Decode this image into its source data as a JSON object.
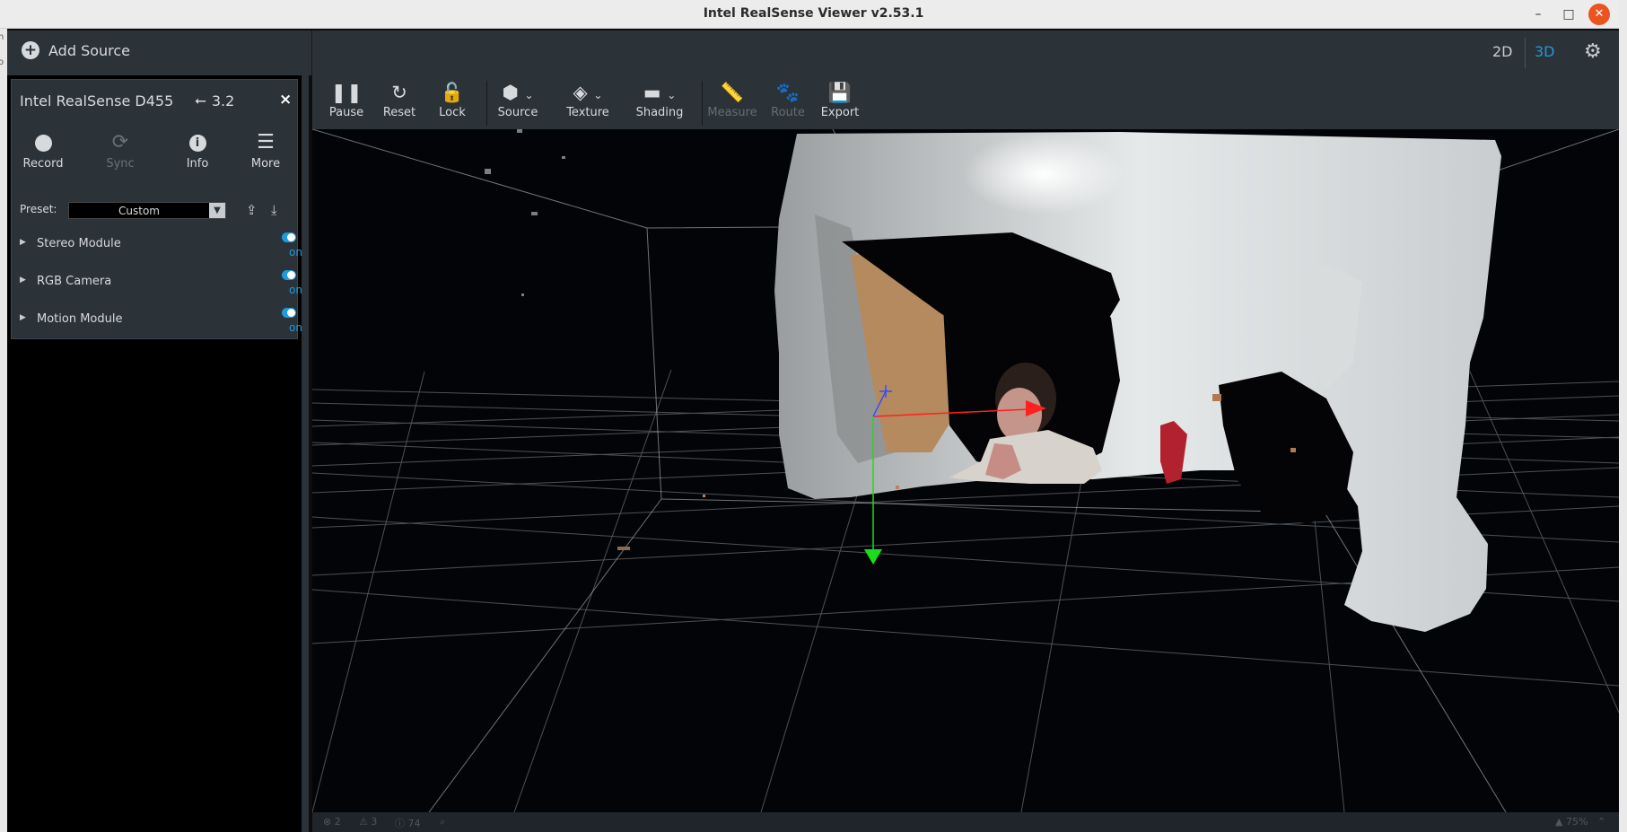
{
  "window": {
    "title": "Intel RealSense Viewer v2.53.1",
    "minimize": "–",
    "maximize": "□",
    "close": "✕"
  },
  "left_edge": {
    "top_fragment": "n",
    "bottom_fragment": "o"
  },
  "header": {
    "add_source": "Add Source",
    "mode_2d": "2D",
    "mode_3d": "3D",
    "active_mode": "3D"
  },
  "device": {
    "name": "Intel RealSense D455",
    "usb_version": "3.2",
    "close": "×",
    "buttons": [
      {
        "label": "Record",
        "icon": "record-icon",
        "enabled": true
      },
      {
        "label": "Sync",
        "icon": "sync-icon",
        "enabled": false
      },
      {
        "label": "Info",
        "icon": "info-icon",
        "enabled": true
      },
      {
        "label": "More",
        "icon": "menu-icon",
        "enabled": true
      }
    ],
    "preset_label": "Preset:",
    "preset_value": "Custom",
    "modules": [
      {
        "label": "Stereo Module",
        "state": "on"
      },
      {
        "label": "RGB Camera",
        "state": "on"
      },
      {
        "label": "Motion Module",
        "state": "on"
      }
    ]
  },
  "toolbar": {
    "items": [
      {
        "label": "Pause",
        "icon": "pause-icon",
        "enabled": true
      },
      {
        "label": "Reset",
        "icon": "reset-icon",
        "enabled": true
      },
      {
        "label": "Lock",
        "icon": "lock-icon",
        "enabled": true
      },
      {
        "label": "Source",
        "icon": "cube-icon",
        "enabled": true,
        "dropdown": true
      },
      {
        "label": "Texture",
        "icon": "paint-bucket-icon",
        "enabled": true,
        "dropdown": true
      },
      {
        "label": "Shading",
        "icon": "paint-roller-icon",
        "enabled": true,
        "dropdown": true
      },
      {
        "label": "Measure",
        "icon": "ruler-icon",
        "enabled": false
      },
      {
        "label": "Route",
        "icon": "paw-icon",
        "enabled": false
      },
      {
        "label": "Export",
        "icon": "save-icon",
        "enabled": true
      }
    ]
  },
  "status_bar": {
    "errors": "2",
    "warnings": "3",
    "info": "74",
    "zoom": "75%"
  },
  "colors": {
    "panel": "#2b3238",
    "accent": "#1e9bde",
    "x_axis": "#ff2020",
    "y_axis": "#18e018",
    "z_axis": "#3050ff"
  }
}
